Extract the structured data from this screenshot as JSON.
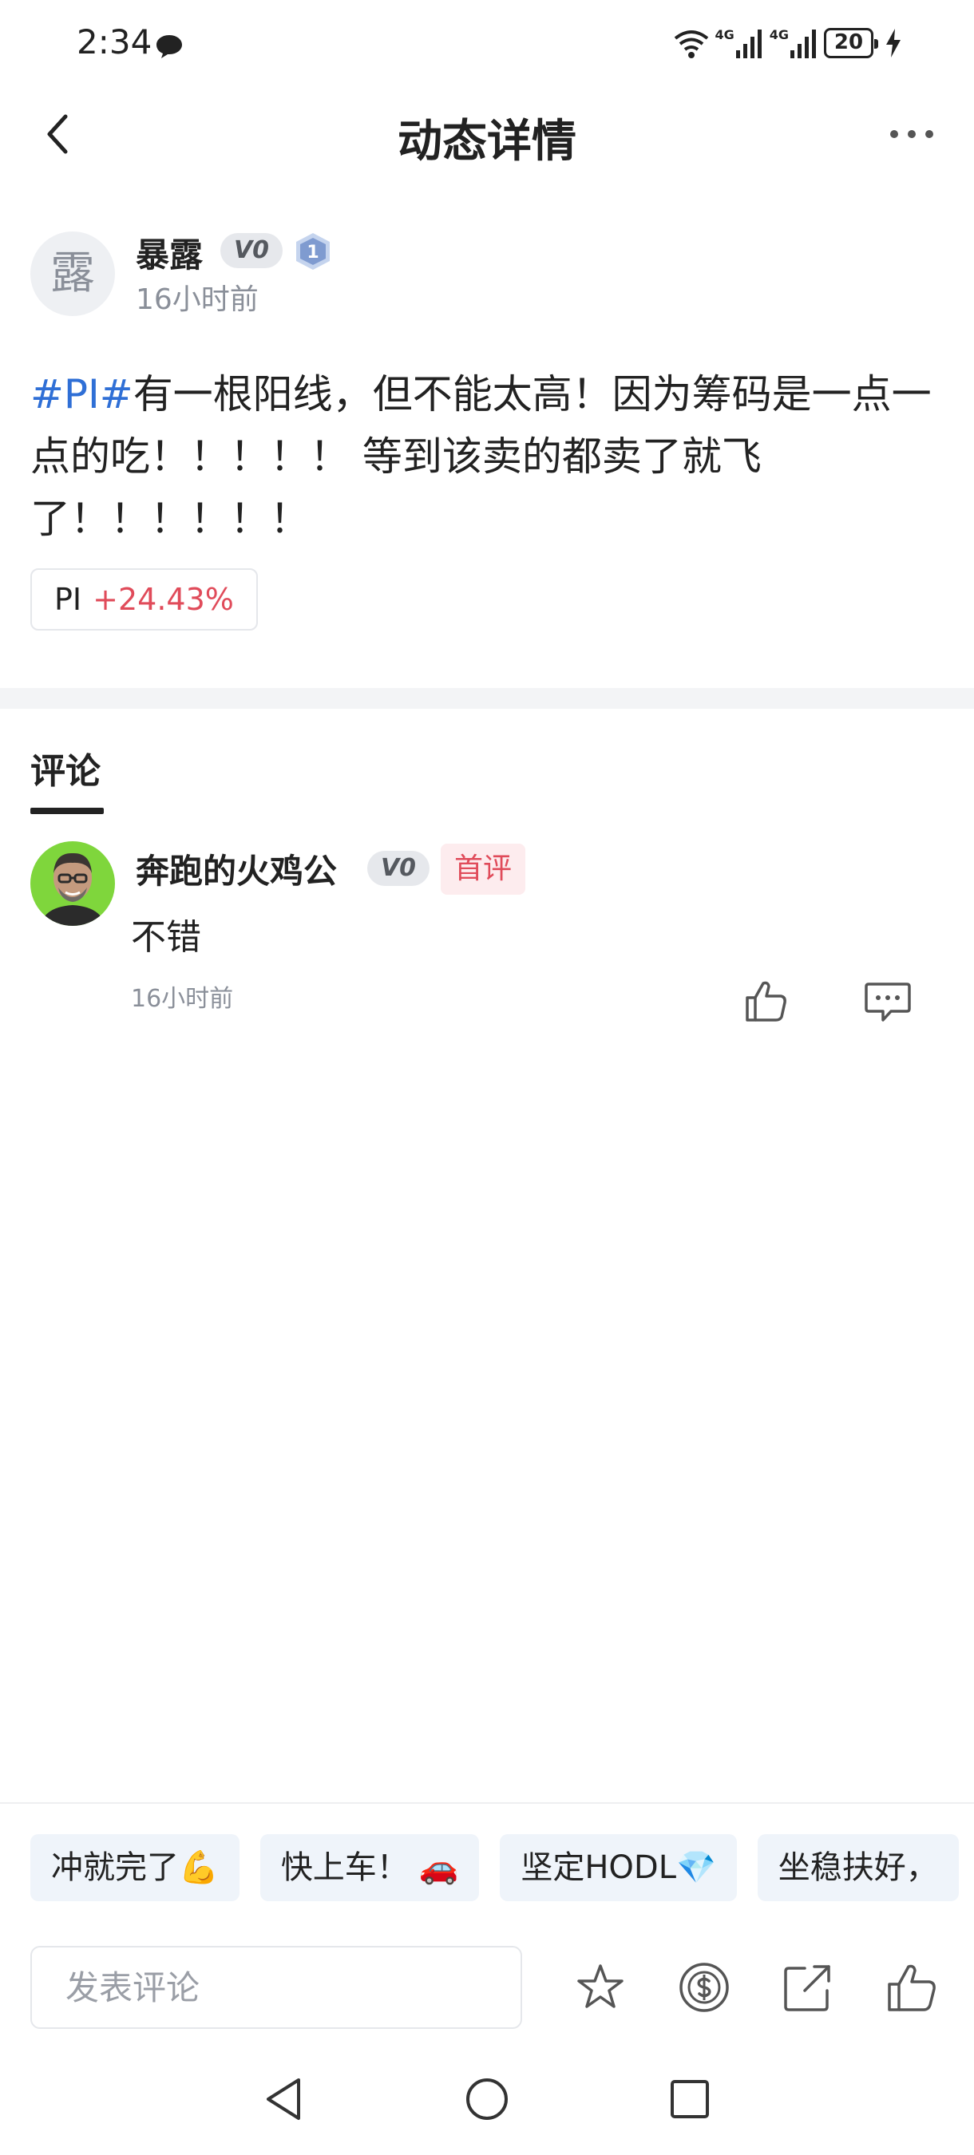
{
  "status_bar": {
    "time": "2:34",
    "network_1": "4G",
    "network_2": "4G",
    "battery": "20"
  },
  "header": {
    "title": "动态详情"
  },
  "post": {
    "author": {
      "avatar_text": "露",
      "name": "暴露",
      "vip_level": "V0",
      "rank": "1"
    },
    "time": "16小时前",
    "topic_tag": "#PI#",
    "content": "有一根阳线，但不能太高！因为筹码是一点一点的吃！！！！！ 等到该卖的都卖了就飞了！！！！！！",
    "ticker": {
      "symbol": "PI",
      "change": "+24.43%"
    }
  },
  "comments": {
    "tab_label": "评论",
    "items": [
      {
        "name": "奔跑的火鸡公",
        "vip_level": "V0",
        "badge": "首评",
        "text": "不错",
        "time": "16小时前"
      }
    ]
  },
  "quick_replies": [
    "冲就完了💪",
    "快上车！ 🚗",
    "坚定HODL💎",
    "坐稳扶好，"
  ],
  "input": {
    "placeholder": "发表评论"
  },
  "icons": {
    "back": "chevron-left-icon",
    "more": "more-dots-icon",
    "like": "thumbs-up-icon",
    "reply": "chat-bubble-icon",
    "favorite": "star-icon",
    "tip": "coin-icon",
    "share": "share-icon"
  },
  "colors": {
    "topic": "#2f6fd6",
    "rise": "#e04b5a",
    "badge_bg": "#fdecee",
    "chip_bg": "#eff4fa"
  }
}
